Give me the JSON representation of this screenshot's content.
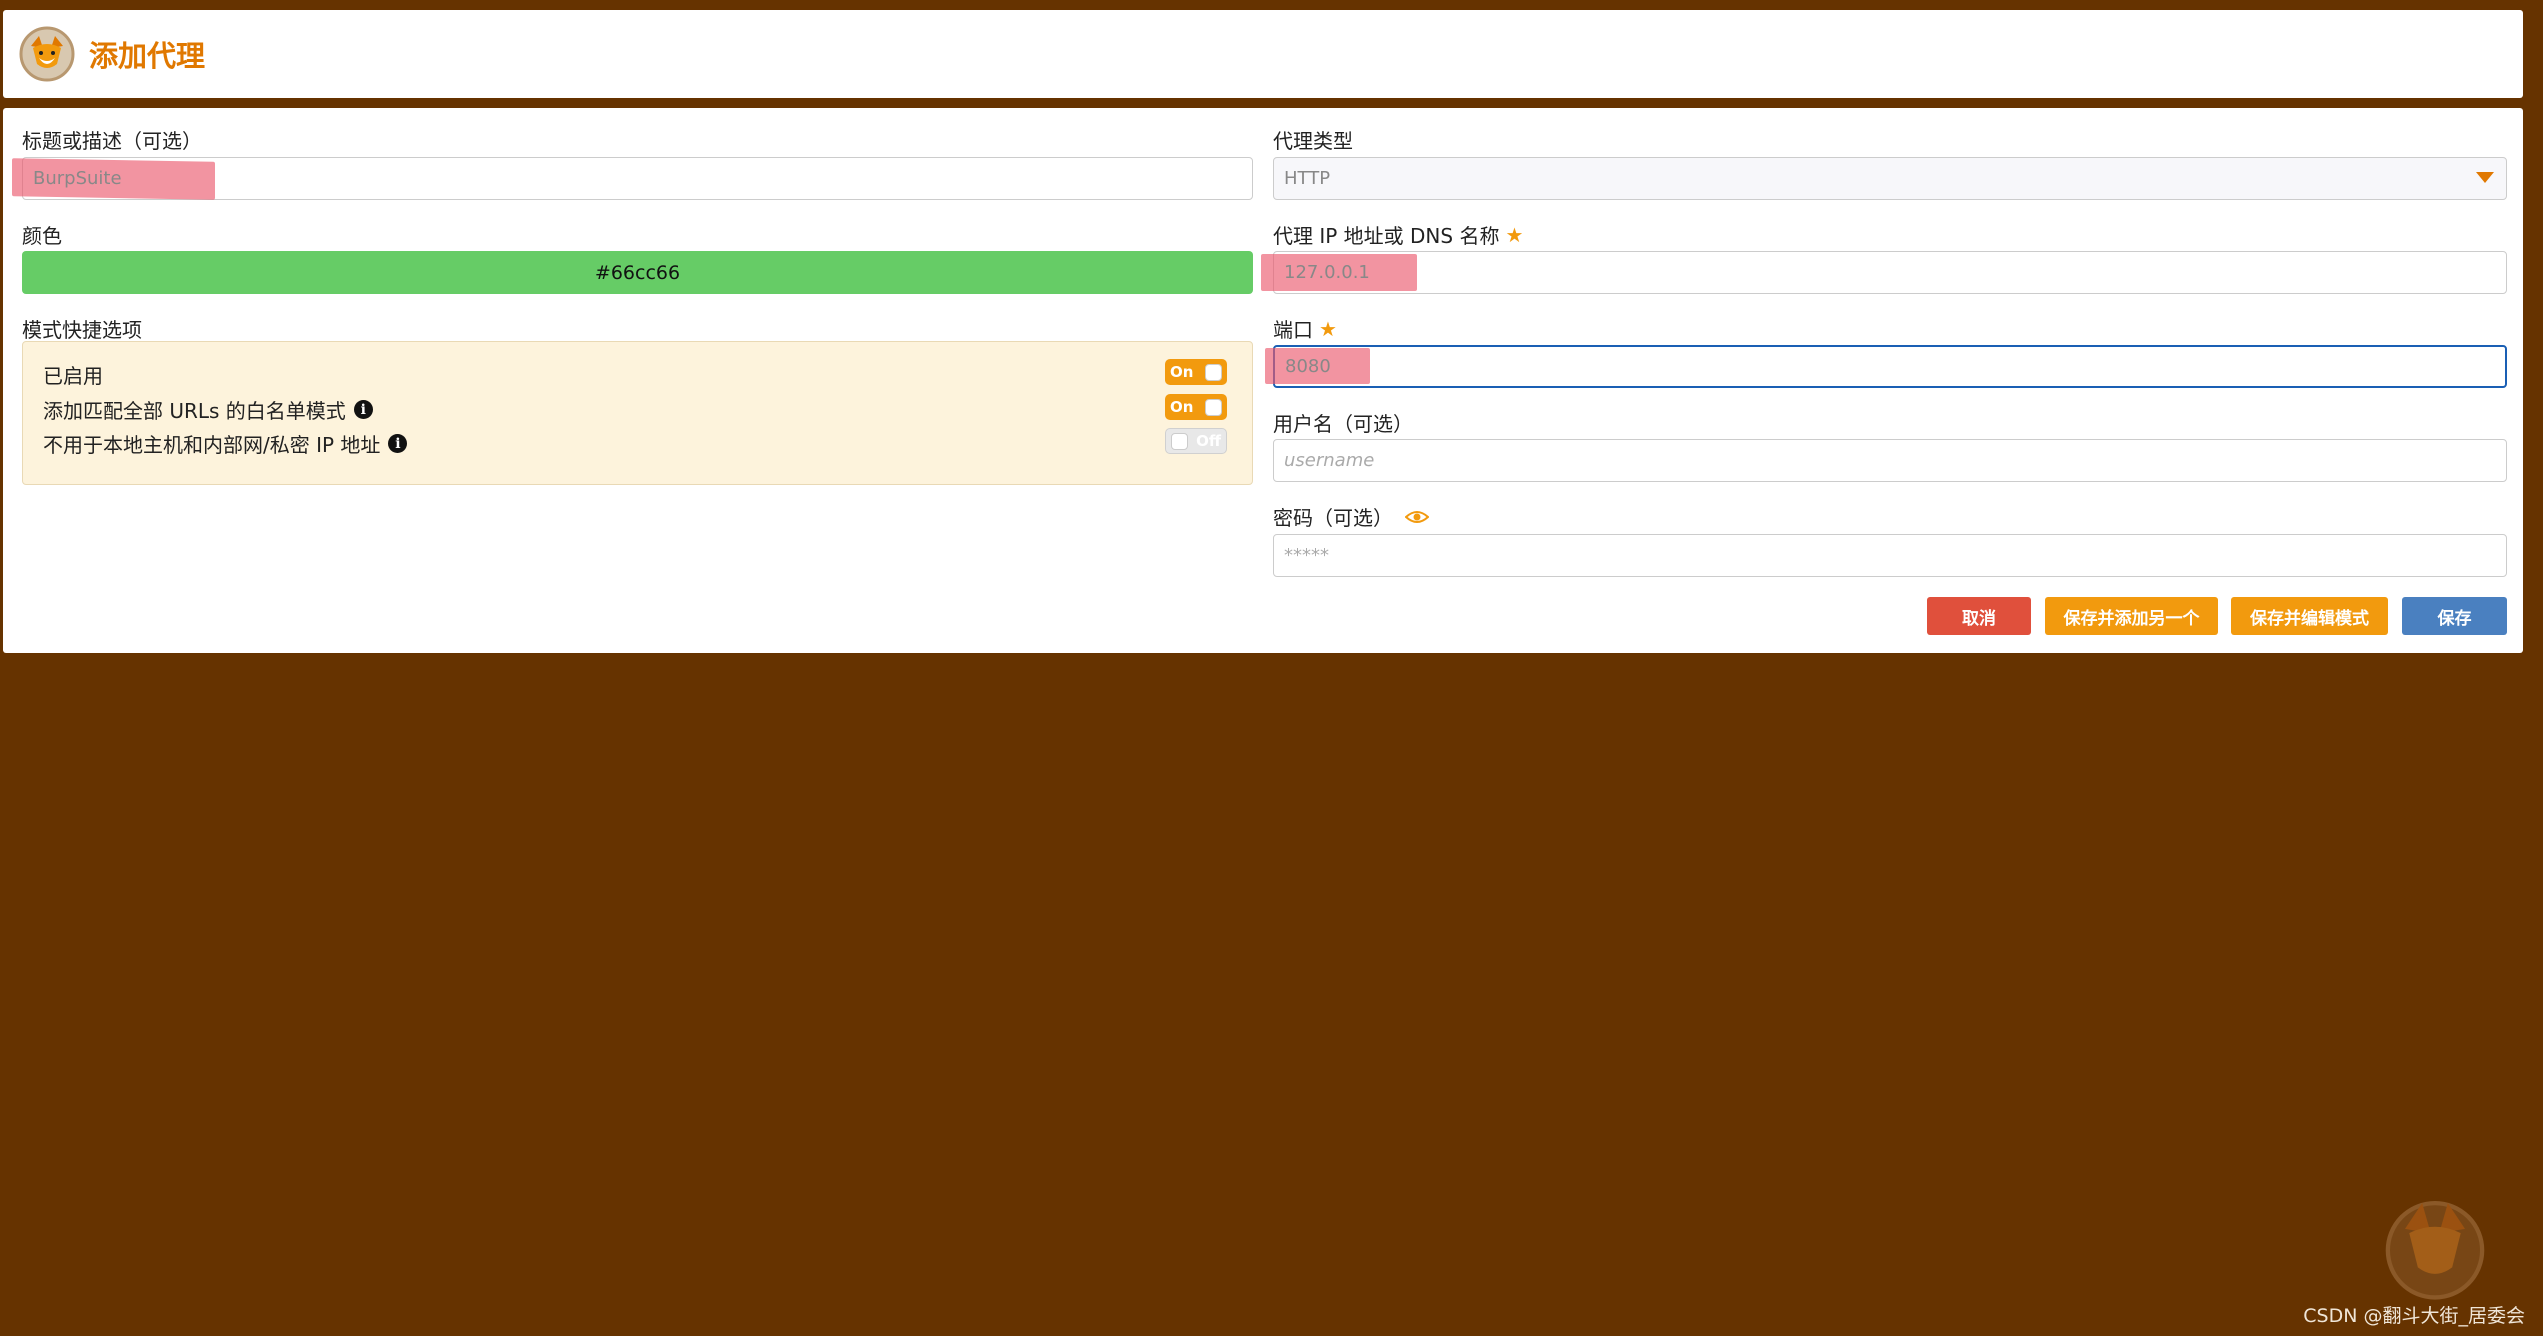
{
  "header": {
    "title": "添加代理"
  },
  "form": {
    "title_label": "标题或描述（可选）",
    "title_value": "BurpSuite",
    "color_label": "颜色",
    "color_value": "#66cc66",
    "pattern_label": "模式快捷选项",
    "patterns": [
      {
        "label": "已启用",
        "state": "On",
        "info": false
      },
      {
        "label": "添加匹配全部 URLs 的白名单模式",
        "state": "On",
        "info": true
      },
      {
        "label": "不用于本地主机和内部网/私密 IP 地址",
        "state": "Off",
        "info": true
      }
    ],
    "proxy_type_label": "代理类型",
    "proxy_type_value": "HTTP",
    "ip_label": "代理 IP 地址或 DNS 名称",
    "ip_value": "127.0.0.1",
    "port_label": "端口",
    "port_value": "8080",
    "username_label": "用户名（可选）",
    "username_placeholder": "username",
    "password_label": "密码（可选）",
    "password_placeholder": "*****"
  },
  "buttons": {
    "cancel": "取消",
    "save_add": "保存并添加另一个",
    "save_edit": "保存并编辑模式",
    "save": "保存"
  },
  "watermark": "CSDN @翻斗大街_居委会",
  "colors": {
    "accent": "#f29a0e",
    "background": "#663300",
    "proxy_color": "#66cc66",
    "save": "#4a80c0",
    "cancel": "#e0503c"
  }
}
